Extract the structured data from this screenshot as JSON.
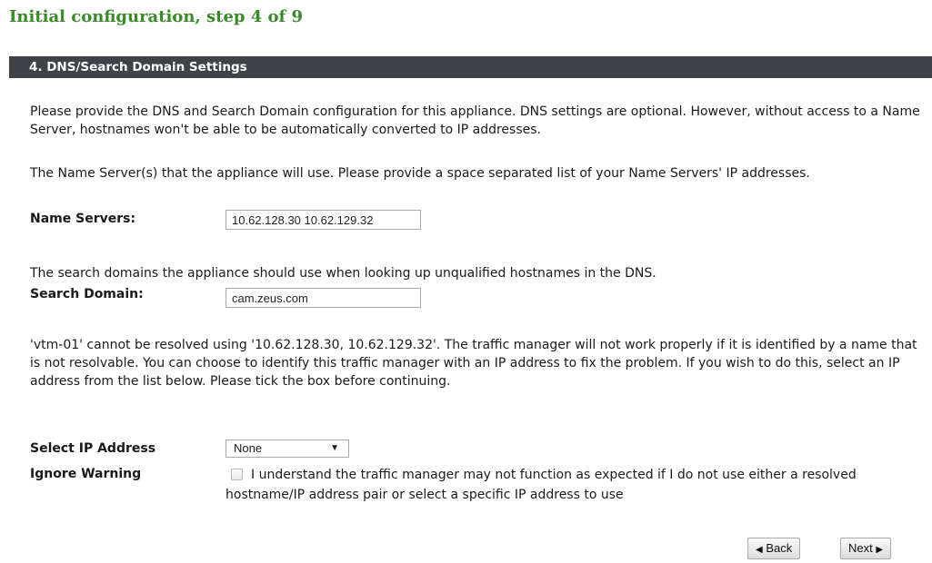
{
  "page": {
    "title": "Initial configuration, step 4 of 9"
  },
  "section": {
    "header": "4. DNS/Search Domain Settings"
  },
  "intro": "Please provide the DNS and Search Domain configuration for this appliance. DNS settings are optional. However, without access to a Name Server, hostnames won't be able to be automatically converted to IP addresses.",
  "name_servers": {
    "description": "The Name Server(s) that the appliance will use. Please provide a space separated list of your Name Servers' IP addresses.",
    "label": "Name Servers:",
    "value": "10.62.128.30 10.62.129.32"
  },
  "search_domain": {
    "description": "The search domains the appliance should use when looking up unqualified hostnames in the DNS.",
    "label": "Search Domain:",
    "value": "cam.zeus.com"
  },
  "warning": "'vtm-01' cannot be resolved using '10.62.128.30, 10.62.129.32'. The traffic manager will not work properly if it is identified by a name that is not resolvable. You can choose to identify this traffic manager with an IP address to fix the problem. If you wish to do this, select an IP address from the list below. Please tick the box before continuing.",
  "select_ip": {
    "label": "Select IP Address",
    "selected": "None"
  },
  "ignore_warning": {
    "label": "Ignore Warning",
    "checked": false,
    "text": "I understand the traffic manager may not function as expected if I do not use either a resolved hostname/IP address pair or select a specific IP address to use"
  },
  "buttons": {
    "back": "Back",
    "next": "Next"
  },
  "icons": {
    "back": "left-triangle-icon",
    "next": "right-triangle-icon",
    "dropdown": "down-triangle-icon"
  },
  "colors": {
    "title": "#3a8a2a",
    "header_bg": "#3f4247"
  }
}
